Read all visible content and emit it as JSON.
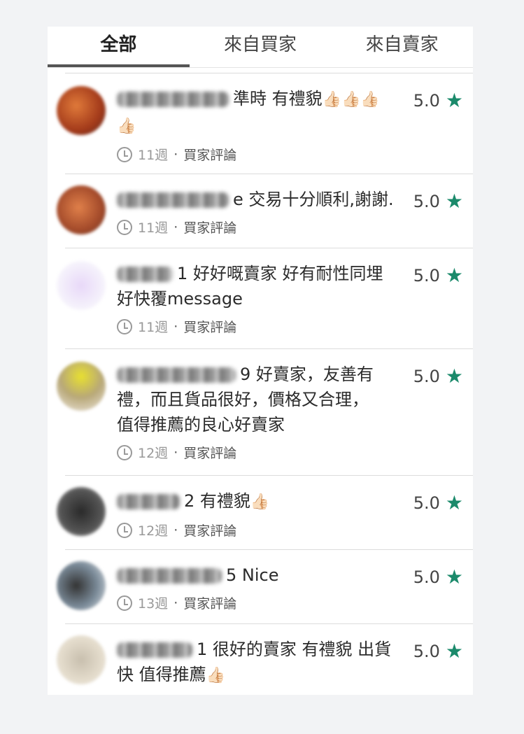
{
  "tabs": [
    {
      "label": "全部",
      "active": true
    },
    {
      "label": "來自買家",
      "active": false
    },
    {
      "label": "來自賣家",
      "active": false
    }
  ],
  "reviews": [
    {
      "text": "準時 有禮貌",
      "thumbs": "👍🏻👍🏻👍🏻👍🏻",
      "age": "11週",
      "type": "買家評論",
      "rating": "5.0"
    },
    {
      "text": "e 交易十分順利,謝謝.",
      "thumbs": "",
      "age": "11週",
      "type": "買家評論",
      "rating": "5.0"
    },
    {
      "text": "1 好好嘅賣家 好有耐性同埋好快覆message",
      "thumbs": "",
      "age": "11週",
      "type": "買家評論",
      "rating": "5.0"
    },
    {
      "text": "9 好賣家，友善有禮，而且貨品很好，價格又合理，值得推薦的良心好賣家",
      "thumbs": "",
      "age": "12週",
      "type": "買家評論",
      "rating": "5.0"
    },
    {
      "text": "2 有禮貌",
      "thumbs": "👍🏻",
      "age": "12週",
      "type": "買家評論",
      "rating": "5.0"
    },
    {
      "text": "5 Nice",
      "thumbs": "",
      "age": "13週",
      "type": "買家評論",
      "rating": "5.0"
    },
    {
      "text": "1 很好的賣家 有禮貌 出貨快 值得推薦",
      "thumbs": "👍🏻",
      "age": "",
      "type": "",
      "rating": "5.0"
    }
  ],
  "colors": {
    "star": "#1b8a6b",
    "tab_indicator": "#555555"
  },
  "icons": {
    "rating": "star-icon",
    "time": "clock-icon"
  }
}
